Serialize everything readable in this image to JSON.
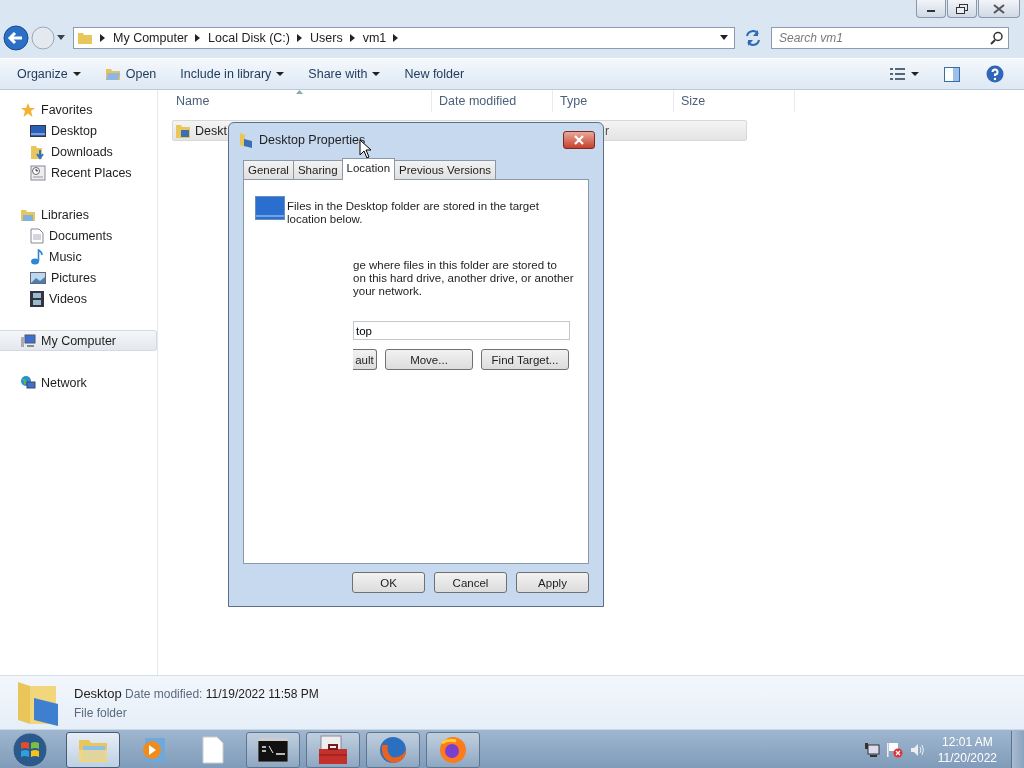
{
  "address_bar": {
    "breadcrumbs": [
      "My Computer",
      "Local Disk (C:)",
      "Users",
      "vm1"
    ]
  },
  "search": {
    "placeholder": "Search vm1"
  },
  "toolbar": [
    {
      "label": "Organize",
      "kind": "dropdown"
    },
    {
      "label": "Open",
      "kind": "icon"
    },
    {
      "label": "Include in library",
      "kind": "dropdown"
    },
    {
      "label": "Share with",
      "kind": "dropdown"
    },
    {
      "label": "New folder",
      "kind": "plain"
    }
  ],
  "sidebar": [
    {
      "label": "Favorites",
      "selected": false,
      "children": [
        {
          "label": "Desktop",
          "selected": false
        },
        {
          "label": "Downloads",
          "selected": false
        },
        {
          "label": "Recent Places",
          "selected": false
        }
      ]
    },
    {
      "label": "Libraries",
      "selected": false,
      "children": [
        {
          "label": "Documents",
          "selected": false
        },
        {
          "label": "Music",
          "selected": false
        },
        {
          "label": "Pictures",
          "selected": false
        },
        {
          "label": "Videos",
          "selected": false
        }
      ]
    },
    {
      "label": "My Computer",
      "selected": true
    },
    {
      "label": "Network",
      "selected": false
    }
  ],
  "columns": [
    "Name",
    "Date modified",
    "Type",
    "Size"
  ],
  "rows": [
    {
      "name": "Deskt",
      "type": "r",
      "selected": true
    }
  ],
  "dialog": {
    "title": "Desktop Properties",
    "tabs": [
      {
        "label": "General",
        "selected": false
      },
      {
        "label": "Sharing",
        "selected": false
      },
      {
        "label": "Location",
        "selected": true
      },
      {
        "label": "Previous Versions",
        "selected": false
      }
    ],
    "description": "Files in the Desktop folder are stored in the target location below.",
    "instructions": [
      "ge where files in this folder are stored to",
      "on this hard drive, another drive, or another",
      "your network."
    ],
    "path": "top",
    "buttons": [
      "ault",
      "Move...",
      "Find Target..."
    ],
    "footer_buttons": [
      "OK",
      "Cancel",
      "Apply"
    ]
  },
  "details": {
    "name": "Desktop",
    "date_label": "Date modified:",
    "date": "11/19/2022 11:58 PM",
    "type": "File folder"
  },
  "taskbar": {
    "apps": [
      {
        "selected": true,
        "running": true
      },
      {
        "selected": false,
        "running": false
      },
      {
        "selected": false,
        "running": false
      },
      {
        "selected": false,
        "running": true
      },
      {
        "selected": false,
        "running": true
      },
      {
        "selected": false,
        "running": true
      },
      {
        "selected": false,
        "running": true
      }
    ],
    "time": "12:01 AM",
    "date": "11/20/2022"
  }
}
